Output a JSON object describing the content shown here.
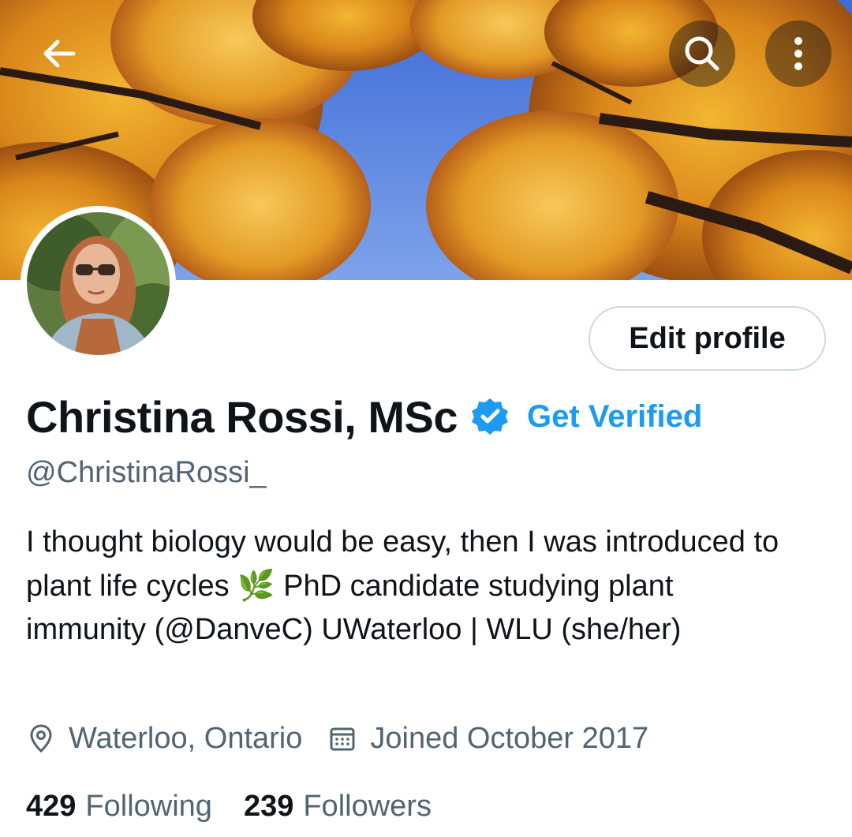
{
  "profile": {
    "display_name": "Christina Rossi, MSc",
    "handle": "@ChristinaRossi_",
    "get_verified_label": "Get Verified",
    "edit_profile_label": "Edit profile",
    "bio": {
      "text_before": "I thought biology would be easy, then I was introduced to plant life cycles ",
      "emoji": "🌿",
      "text_middle": " PhD candidate studying plant immunity (",
      "mention": "@DanveC",
      "text_after": ") UWaterloo | WLU (she/her)"
    },
    "location": "Waterloo, Ontario",
    "joined": "Joined October 2017",
    "following_count": "429",
    "following_label": "Following",
    "followers_count": "239",
    "followers_label": "Followers"
  },
  "icons": {
    "back": "arrow-left-icon",
    "search": "search-icon",
    "more": "more-vertical-icon",
    "verified": "verified-badge-icon",
    "location": "location-pin-icon",
    "calendar": "calendar-icon"
  },
  "colors": {
    "accent": "#1d9bf0",
    "text_primary": "#0f1419",
    "text_secondary": "#536471",
    "border": "#cfd9de"
  }
}
